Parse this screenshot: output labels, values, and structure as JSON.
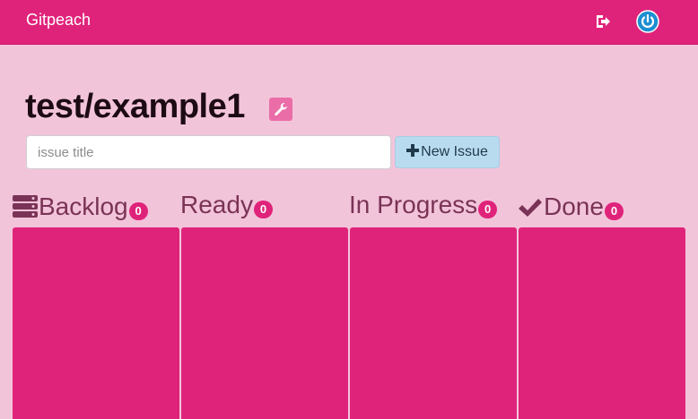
{
  "navbar": {
    "brand": "Gitpeach",
    "signout_icon": "sign-out-icon",
    "power_icon": "power-icon"
  },
  "repo": {
    "title": "test/example1",
    "settings_icon": "wrench-icon"
  },
  "new_issue": {
    "placeholder": "issue title",
    "value": "",
    "button_label": "New Issue",
    "button_icon": "plus-icon"
  },
  "columns": [
    {
      "label": "Backlog",
      "count": "0",
      "icon": "stack-icon"
    },
    {
      "label": "Ready",
      "count": "0",
      "icon": ""
    },
    {
      "label": "In Progress",
      "count": "0",
      "icon": ""
    },
    {
      "label": "Done",
      "count": "0",
      "icon": "check-icon"
    }
  ],
  "colors": {
    "primary": "#e0237a",
    "background": "#f2c4da",
    "button_blue": "#b9dbf0",
    "power_blue": "#1c8fd0"
  }
}
